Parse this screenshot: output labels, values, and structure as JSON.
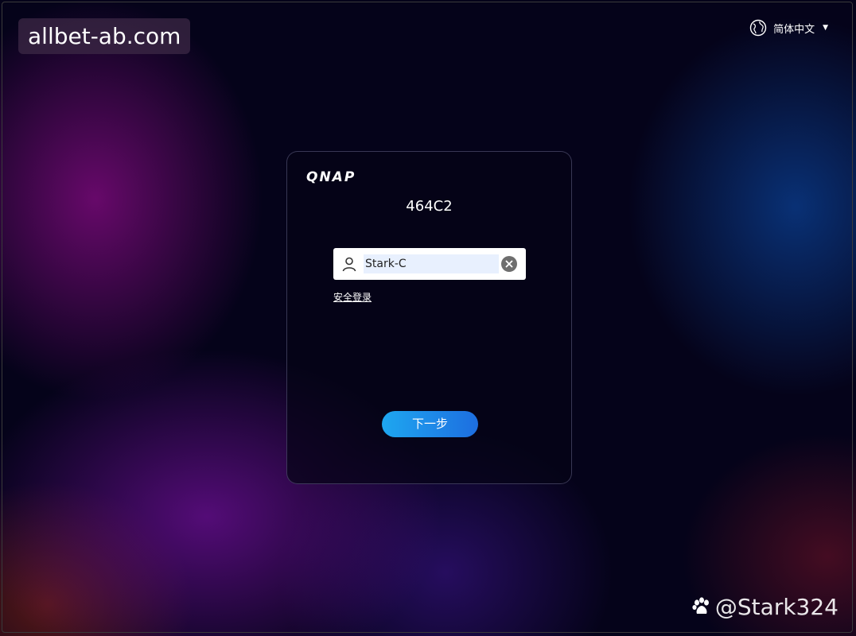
{
  "watermark_top": "allbet-ab.com",
  "language": {
    "label": "简体中文",
    "icon": "globe-icon",
    "dropdown_icon": "caret-down-icon"
  },
  "login": {
    "brand": "QNAP",
    "device_name": "464C2",
    "username": {
      "value": "Stark-C",
      "icon": "user-icon",
      "clear_icon": "clear-icon"
    },
    "secure_login_link": "安全登录",
    "next_button": "下一步"
  },
  "watermark_bottom": {
    "text": "@Stark324",
    "icon": "baidu-paw-icon"
  },
  "colors": {
    "button_start": "#1ea7f0",
    "button_end": "#1d6ee0",
    "field_highlight": "#e8f0fe"
  }
}
